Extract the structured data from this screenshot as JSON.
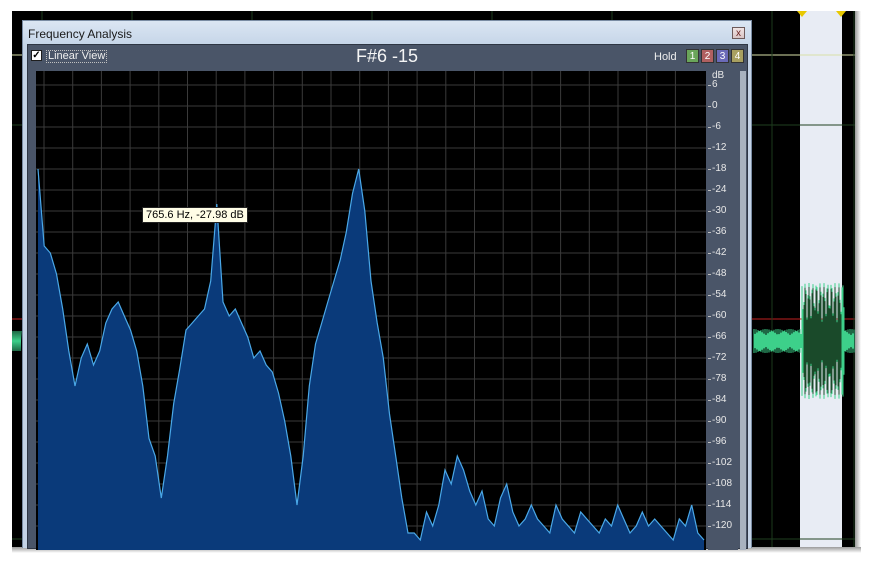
{
  "window": {
    "title": "Frequency Analysis",
    "close_glyph": "x"
  },
  "toolbar": {
    "linear_view_label": "Linear View",
    "linear_view_checked": true,
    "note_display": "F#6 -15",
    "hold_label": "Hold",
    "hold_buttons": [
      {
        "label": "1",
        "color": "#6aa55a"
      },
      {
        "label": "2",
        "color": "#b06060"
      },
      {
        "label": "3",
        "color": "#6a6ab8"
      },
      {
        "label": "4",
        "color": "#a8a060"
      }
    ]
  },
  "tooltip": {
    "text": "765.6 Hz, -27.98 dB"
  },
  "chart_data": {
    "type": "area",
    "title": "",
    "xlabel": "",
    "ylabel": "dB",
    "y_unit_label": "dB",
    "ylim": [
      -126,
      12
    ],
    "y_ticks": [
      6,
      0,
      -6,
      -12,
      -18,
      -24,
      -30,
      -36,
      -42,
      -48,
      -54,
      -60,
      -66,
      -72,
      -78,
      -84,
      -90,
      -96,
      -102,
      -108,
      -114,
      -120
    ],
    "grid": true,
    "series_color": "#0a3a7a",
    "line_color": "#4aa8e8",
    "spectrum_db": [
      -18,
      -40,
      -42,
      -48,
      -58,
      -70,
      -80,
      -72,
      -68,
      -74,
      -70,
      -62,
      -58,
      -56,
      -60,
      -64,
      -70,
      -80,
      -95,
      -100,
      -112,
      -100,
      -85,
      -75,
      -64,
      -62,
      -60,
      -58,
      -50,
      -28,
      -56,
      -60,
      -58,
      -62,
      -66,
      -72,
      -70,
      -74,
      -76,
      -82,
      -90,
      -100,
      -114,
      -100,
      -80,
      -68,
      -62,
      -56,
      -50,
      -44,
      -36,
      -25,
      -18,
      -30,
      -50,
      -62,
      -72,
      -88,
      -100,
      -112,
      -122,
      -122,
      -124,
      -116,
      -120,
      -114,
      -104,
      -108,
      -100,
      -104,
      -110,
      -114,
      -110,
      -118,
      -120,
      -112,
      -108,
      -116,
      -120,
      -118,
      -114,
      -118,
      -120,
      -122,
      -114,
      -118,
      -120,
      -122,
      -116,
      -118,
      -120,
      -122,
      -118,
      -120,
      -114,
      -118,
      -122,
      -120,
      -116,
      -120,
      -118,
      -120,
      -122,
      -124,
      -118,
      -120,
      -114,
      -122,
      -124
    ]
  },
  "background_app": {
    "selection_color": "#e8ecf4",
    "waveform_color": "#3dd08a",
    "center_line_color": "#c02020"
  }
}
